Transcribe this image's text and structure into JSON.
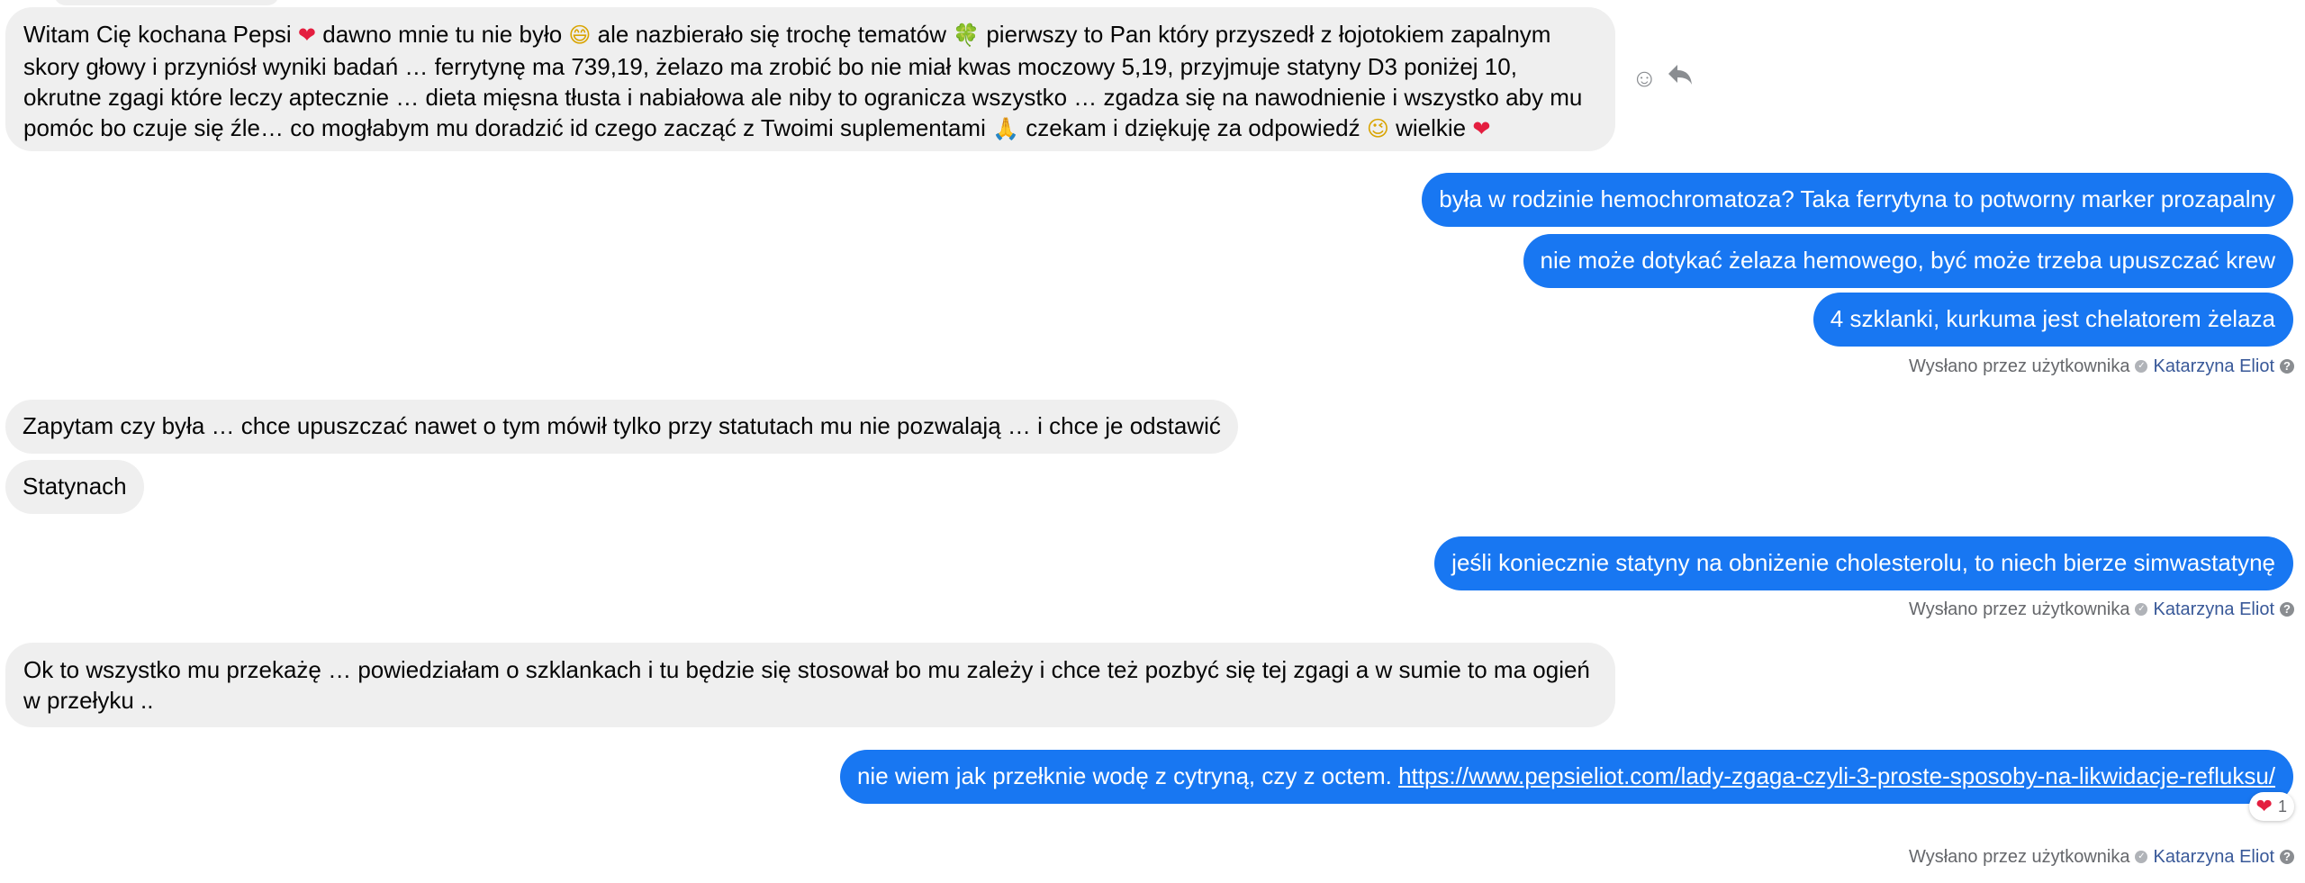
{
  "messages": {
    "m1": {
      "part1": "Witam Cię kochana Pepsi ",
      "emoji1": "❤",
      "part2": " dawno mnie tu nie było ",
      "emoji2": "😄",
      "part3": " ale nazbierało się trochę tematów ",
      "emoji3": "🍀",
      "part4": " pierwszy to Pan który przyszedł z łojotokiem zapalnym skory głowy i przyniósł wyniki badań … ferrytynę ma 739,19, żelazo ma zrobić bo nie miał kwas moczowy 5,19, przyjmuje statyny D3 poniżej 10, okrutne zgagi które leczy aptecznie … dieta mięsna tłusta i nabiałowa ale niby to ogranicza wszystko … zgadza się na nawodnienie i wszystko aby mu pomóc bo czuje się źle… co mogłabym mu doradzić id czego zacząć z Twoimi suplementami ",
      "emoji4": "🙏",
      "part5": " czekam i dziękuję za odpowiedź ",
      "emoji5": "😉",
      "part6": " wielkie ",
      "emoji6": "❤"
    },
    "m2": "była w rodzinie hemochromatoza? Taka ferrytyna to potworny marker prozapalny",
    "m3": "nie może dotykać żelaza hemowego, być może trzeba upuszczać krew",
    "m4": "4 szklanki, kurkuma jest chelatorem żelaza",
    "m5": "Zapytam czy była … chce upuszczać nawet o tym mówił tylko przy statutach mu nie pozwalają … i chce je odstawić",
    "m6": "Statynach",
    "m7": "jeśli koniecznie statyny na obniżenie cholesterolu, to niech bierze simwastatynę",
    "m8": "Ok to wszystko mu przekażę … powiedziałam o szklankach i tu będzie się stosował bo mu zależy i chce też pozbyć się tej zgagi a w sumie to ma ogień w przełyku ..",
    "m9": {
      "text": "nie wiem jak przełknie wodę z cytryną, czy z octem. ",
      "link": "https://www.pepsieliot.com/lady-zgaga-czyli-3-proste-sposoby-na-likwidacje-refluksu/"
    }
  },
  "meta": {
    "sent_by": "Wysłano przez użytkownika",
    "author": "Katarzyna Eliot",
    "help": "?"
  },
  "reaction": {
    "emoji": "❤",
    "count": "1"
  },
  "hover_actions": {
    "react_icon": "☺",
    "reply_icon": "reply-icon"
  },
  "colors": {
    "outgoing": "#1877f2",
    "incoming": "#efefef",
    "link": "#385898"
  }
}
